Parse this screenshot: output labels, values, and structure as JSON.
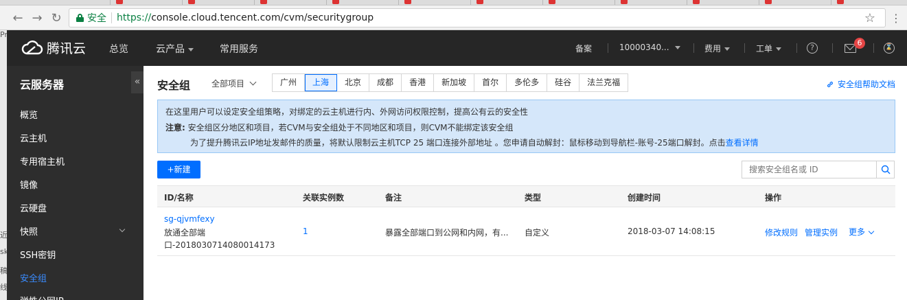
{
  "browser": {
    "secure_label": "安全",
    "url_scheme": "https://",
    "url_rest": "console.cloud.tencent.com/cvm/securitygroup"
  },
  "left_strip": {
    "fragments": [
      "Pr",
      "近",
      "sk",
      "稿",
      "线"
    ]
  },
  "topnav": {
    "logo_text": "腾讯云",
    "items": [
      "总览",
      "云产品",
      "常用服务"
    ],
    "right": {
      "beian": "备案",
      "account": "10000340...",
      "fees": "费用",
      "tickets": "工单",
      "mail_badge": "6"
    }
  },
  "sidebar": {
    "title": "云服务器",
    "collapse_glyph": "«",
    "items": [
      {
        "label": "概览"
      },
      {
        "label": "云主机"
      },
      {
        "label": "专用宿主机"
      },
      {
        "label": "镜像"
      },
      {
        "label": "云硬盘"
      },
      {
        "label": "快照"
      },
      {
        "label": "SSH密钥"
      },
      {
        "label": "安全组"
      },
      {
        "label": "弹性公网IP"
      }
    ]
  },
  "main": {
    "title": "安全组",
    "project_select": "全部项目",
    "regions": [
      "广州",
      "上海",
      "北京",
      "成都",
      "香港",
      "新加坡",
      "首尔",
      "多伦多",
      "硅谷",
      "法兰克福"
    ],
    "active_region": "上海",
    "help_link": "安全组帮助文档",
    "notice": {
      "line1": "在这里用户可以设定安全组策略，对绑定的云主机进行内、外网访问权限控制，提高公有云的安全性",
      "line2_label": "注意:",
      "line2_text": "安全组区分地区和项目，若CVM与安全组处于不同地区和项目，则CVM不能绑定该安全组",
      "line3_text": "为了提升腾讯云IP地址发邮件的质量，将默认限制云主机TCP 25 端口连接外部地址 。您申请自动解封：鼠标移动到导航栏-账号-25端口解封。点击",
      "line3_link": "查看详情"
    },
    "new_button": "+新建",
    "search_placeholder": "搜索安全组名或 ID",
    "table": {
      "headers": [
        "ID/名称",
        "关联实例数",
        "备注",
        "类型",
        "创建时间",
        "操作"
      ],
      "rows": [
        {
          "id": "sg-qjvmfexy",
          "name_line1": "放通全部端",
          "name_line2": "口-2018030714080014173",
          "instances": "1",
          "remark": "暴露全部端口到公网和内网，有...",
          "type": "自定义",
          "created": "2018-03-07 14:08:15",
          "actions": [
            "修改规则",
            "管理实例",
            "更多"
          ]
        }
      ]
    }
  }
}
